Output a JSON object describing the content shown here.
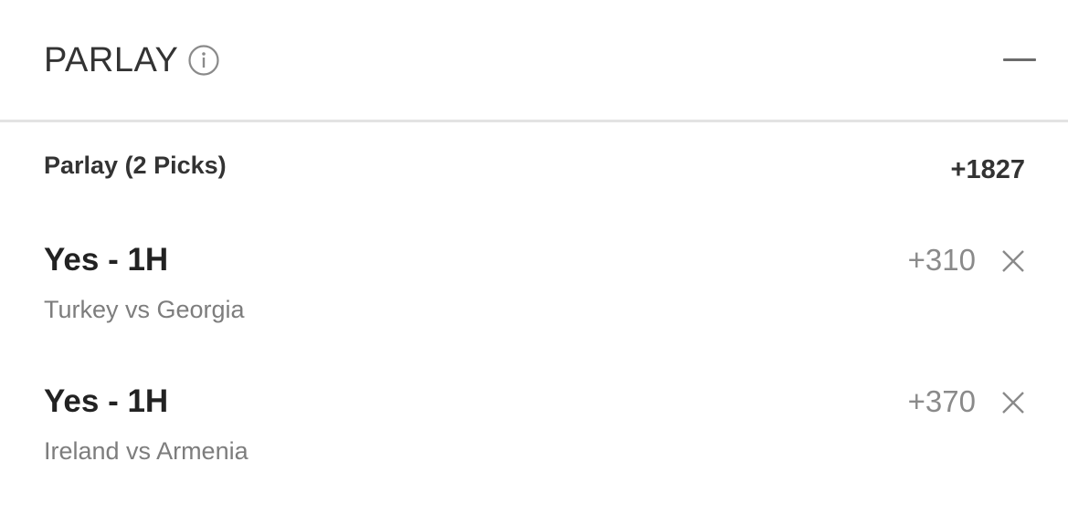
{
  "header": {
    "title": "PARLAY",
    "info_icon": "info-circle-icon",
    "collapse_icon": "minus-icon"
  },
  "summary": {
    "label": "Parlay (2 Picks)",
    "odds": "+1827"
  },
  "picks": [
    {
      "title": "Yes - 1H",
      "event": "Turkey vs Georgia",
      "odds": "+310",
      "remove_icon": "close-icon"
    },
    {
      "title": "Yes - 1H",
      "event": "Ireland vs Armenia",
      "odds": "+370",
      "remove_icon": "close-icon"
    }
  ],
  "colors": {
    "text_primary": "#222222",
    "text_secondary": "#7d7d7d",
    "divider": "#e3e3e3"
  }
}
